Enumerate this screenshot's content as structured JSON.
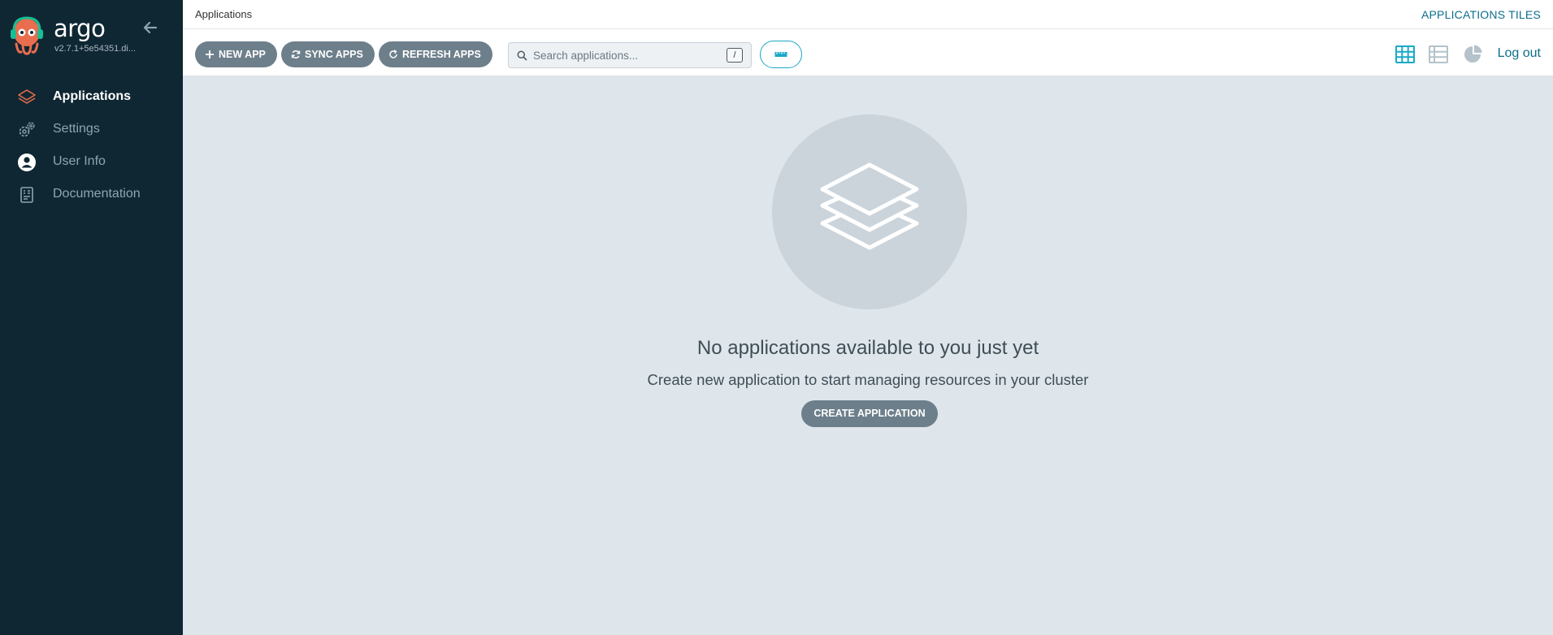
{
  "sidebar": {
    "brand_name": "argo",
    "version": "v2.7.1+5e54351.di...",
    "items": [
      {
        "label": "Applications",
        "active": true
      },
      {
        "label": "Settings",
        "active": false
      },
      {
        "label": "User Info",
        "active": false
      },
      {
        "label": "Documentation",
        "active": false
      }
    ]
  },
  "header": {
    "page_title": "Applications",
    "view_title": "APPLICATIONS TILES"
  },
  "toolbar": {
    "new_app_label": "NEW APP",
    "sync_apps_label": "SYNC APPS",
    "refresh_apps_label": "REFRESH APPS",
    "search_placeholder": "Search applications...",
    "search_value": "",
    "search_shortcut": "/",
    "logout_label": "Log out"
  },
  "empty_state": {
    "title": "No applications available to you just yet",
    "subtitle": "Create new application to start managing resources in your cluster",
    "button_label": "CREATE APPLICATION"
  },
  "colors": {
    "sidebar_bg": "#0f2733",
    "accent": "#1aa9c7",
    "active_icon": "#e96d4f",
    "button_bg": "#6d7f8b",
    "page_bg": "#dee6eb"
  }
}
